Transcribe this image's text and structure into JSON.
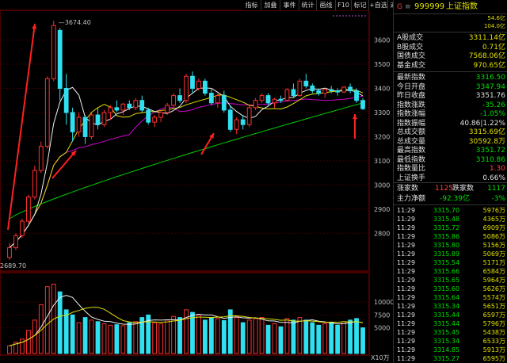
{
  "toolbar": {
    "items": [
      "指标",
      "加叠",
      "事件",
      "统计",
      "画线",
      "F10",
      "标记",
      "+自选",
      "返回"
    ]
  },
  "chart": {
    "y_labels": [
      "3600",
      "3500",
      "3400",
      "3300",
      "3200",
      "3100",
      "3000",
      "2900",
      "2800"
    ],
    "peak_label": "3674.40",
    "low_label": "2689.70",
    "vol_labels": [
      "10000",
      "7500",
      "5000"
    ],
    "vol_unit": "X10万"
  },
  "chart_data": {
    "type": "candlestick",
    "candles": [
      [
        2700,
        2760,
        2690,
        2740
      ],
      [
        2740,
        2800,
        2730,
        2790
      ],
      [
        2790,
        2860,
        2780,
        2850
      ],
      [
        2850,
        2960,
        2840,
        2950
      ],
      [
        2950,
        3080,
        2940,
        3060
      ],
      [
        3060,
        3180,
        3050,
        3160
      ],
      [
        3160,
        3450,
        3150,
        3440
      ],
      [
        3440,
        3680,
        3430,
        3660
      ],
      [
        3640,
        3650,
        3350,
        3400
      ],
      [
        3400,
        3460,
        3250,
        3300
      ],
      [
        3300,
        3320,
        3180,
        3220
      ],
      [
        3220,
        3300,
        3200,
        3280
      ],
      [
        3280,
        3290,
        3170,
        3200
      ],
      [
        3200,
        3300,
        3190,
        3290
      ],
      [
        3290,
        3320,
        3230,
        3250
      ],
      [
        3250,
        3310,
        3240,
        3300
      ],
      [
        3300,
        3330,
        3270,
        3320
      ],
      [
        3320,
        3350,
        3300,
        3310
      ],
      [
        3310,
        3340,
        3290,
        3335
      ],
      [
        3335,
        3350,
        3310,
        3320
      ],
      [
        3320,
        3360,
        3310,
        3350
      ],
      [
        3350,
        3370,
        3300,
        3310
      ],
      [
        3310,
        3320,
        3250,
        3260
      ],
      [
        3260,
        3290,
        3240,
        3280
      ],
      [
        3280,
        3310,
        3260,
        3300
      ],
      [
        3300,
        3340,
        3290,
        3330
      ],
      [
        3330,
        3380,
        3320,
        3370
      ],
      [
        3370,
        3400,
        3340,
        3350
      ],
      [
        3350,
        3460,
        3340,
        3450
      ],
      [
        3450,
        3470,
        3380,
        3400
      ],
      [
        3400,
        3440,
        3390,
        3430
      ],
      [
        3430,
        3440,
        3370,
        3380
      ],
      [
        3380,
        3400,
        3330,
        3340
      ],
      [
        3340,
        3380,
        3320,
        3370
      ],
      [
        3370,
        3390,
        3300,
        3310
      ],
      [
        3310,
        3330,
        3220,
        3230
      ],
      [
        3230,
        3280,
        3210,
        3270
      ],
      [
        3270,
        3290,
        3230,
        3250
      ],
      [
        3250,
        3330,
        3240,
        3320
      ],
      [
        3320,
        3360,
        3310,
        3350
      ],
      [
        3350,
        3380,
        3340,
        3370
      ],
      [
        3370,
        3380,
        3330,
        3340
      ],
      [
        3340,
        3360,
        3320,
        3355
      ],
      [
        3355,
        3370,
        3340,
        3350
      ],
      [
        3350,
        3400,
        3345,
        3395
      ],
      [
        3395,
        3420,
        3360,
        3370
      ],
      [
        3370,
        3440,
        3365,
        3430
      ],
      [
        3430,
        3460,
        3400,
        3410
      ],
      [
        3410,
        3420,
        3380,
        3390
      ],
      [
        3390,
        3400,
        3370,
        3380
      ],
      [
        3380,
        3400,
        3360,
        3395
      ],
      [
        3395,
        3410,
        3380,
        3390
      ],
      [
        3390,
        3400,
        3370,
        3385
      ],
      [
        3385,
        3410,
        3380,
        3405
      ],
      [
        3405,
        3420,
        3380,
        3390
      ],
      [
        3390,
        3400,
        3340,
        3350
      ],
      [
        3350,
        3360,
        3310,
        3316
      ]
    ],
    "volume": [
      1500,
      2200,
      2800,
      4500,
      6500,
      9500,
      13000,
      13500,
      12000,
      8500,
      7500,
      6000,
      7000,
      6500,
      6200,
      5800,
      5500,
      5600,
      5400,
      6000,
      6200,
      7000,
      7500,
      6000,
      5800,
      6500,
      7200,
      7000,
      8500,
      8000,
      7500,
      6500,
      7000,
      6800,
      6400,
      8500,
      7000,
      6000,
      6500,
      6800,
      7000,
      5500,
      5800,
      5200,
      6800,
      6500,
      7000,
      6500,
      6000,
      5500,
      5800,
      6000,
      5500,
      6200,
      6500,
      6800,
      5000
    ],
    "ylim": [
      2650,
      3720
    ]
  },
  "header": {
    "code": "999999",
    "name": "上证指数",
    "prefix": "G",
    "small1": "54.6亿",
    "small2": "104.0亿"
  },
  "rows": [
    {
      "label": "A股成交",
      "value": "3311.14亿",
      "color": "c-yellow"
    },
    {
      "label": "B股成交",
      "value": "0.71亿",
      "color": "c-yellow"
    },
    {
      "label": "国债成交",
      "value": "7568.06亿",
      "color": "c-yellow"
    },
    {
      "label": "基金成交",
      "value": "970.65亿",
      "color": "c-yellow"
    }
  ],
  "stats": [
    {
      "label": "最新指数",
      "value": "3316.50",
      "color": "c-green"
    },
    {
      "label": "今日开盘",
      "value": "3347.94",
      "color": "c-green"
    },
    {
      "label": "昨日收盘",
      "value": "3351.76",
      "color": "c-white"
    },
    {
      "label": "指数涨跌",
      "value": "-35.26",
      "color": "c-green"
    },
    {
      "label": "指数涨幅",
      "value": "-1.05%",
      "color": "c-green"
    },
    {
      "label": "指数振幅",
      "value": "40.86|1.22%",
      "color": "c-white"
    },
    {
      "label": "总成交额",
      "value": "3315.69亿",
      "color": "c-yellow"
    },
    {
      "label": "总成交量",
      "value": "30592.8万",
      "color": "c-yellow"
    },
    {
      "label": "最高指数",
      "value": "3351.72",
      "color": "c-green"
    },
    {
      "label": "最低指数",
      "value": "3310.86",
      "color": "c-green"
    },
    {
      "label": "指数量比",
      "value": "1.30",
      "color": "c-red"
    },
    {
      "label": "上证换手",
      "value": "0.66%",
      "color": "c-white"
    }
  ],
  "breadth": {
    "up_label": "涨家数",
    "up": "1125",
    "down_label": "跌家数",
    "down": "1117"
  },
  "flow": {
    "label": "主力净额",
    "value": "-92.39亿",
    "pct": "-3%"
  },
  "ticks": [
    [
      "11:29",
      "3315.70",
      "5976万"
    ],
    [
      "11:29",
      "3315.48",
      "4365万"
    ],
    [
      "11:29",
      "3315.72",
      "6909万"
    ],
    [
      "11:29",
      "3315.86",
      "5086万"
    ],
    [
      "11:29",
      "3315.80",
      "5156万"
    ],
    [
      "11:29",
      "3315.89",
      "5069万"
    ],
    [
      "11:29",
      "3315.54",
      "5171万"
    ],
    [
      "11:29",
      "3315.66",
      "6584万"
    ],
    [
      "11:29",
      "3315.65",
      "5964万"
    ],
    [
      "11:29",
      "3315.60",
      "5626万"
    ],
    [
      "11:29",
      "3315.64",
      "5574万"
    ],
    [
      "11:29",
      "3315.34",
      "5651万"
    ],
    [
      "11:29",
      "3315.44",
      "6597万"
    ],
    [
      "11:29",
      "3315.44",
      "5796万"
    ],
    [
      "11:29",
      "3315.45",
      "5438万"
    ],
    [
      "11:29",
      "3315.34",
      "6533万"
    ],
    [
      "11:29",
      "3314.85",
      "5913万"
    ],
    [
      "11:29",
      "3315.27",
      "6595万"
    ]
  ]
}
